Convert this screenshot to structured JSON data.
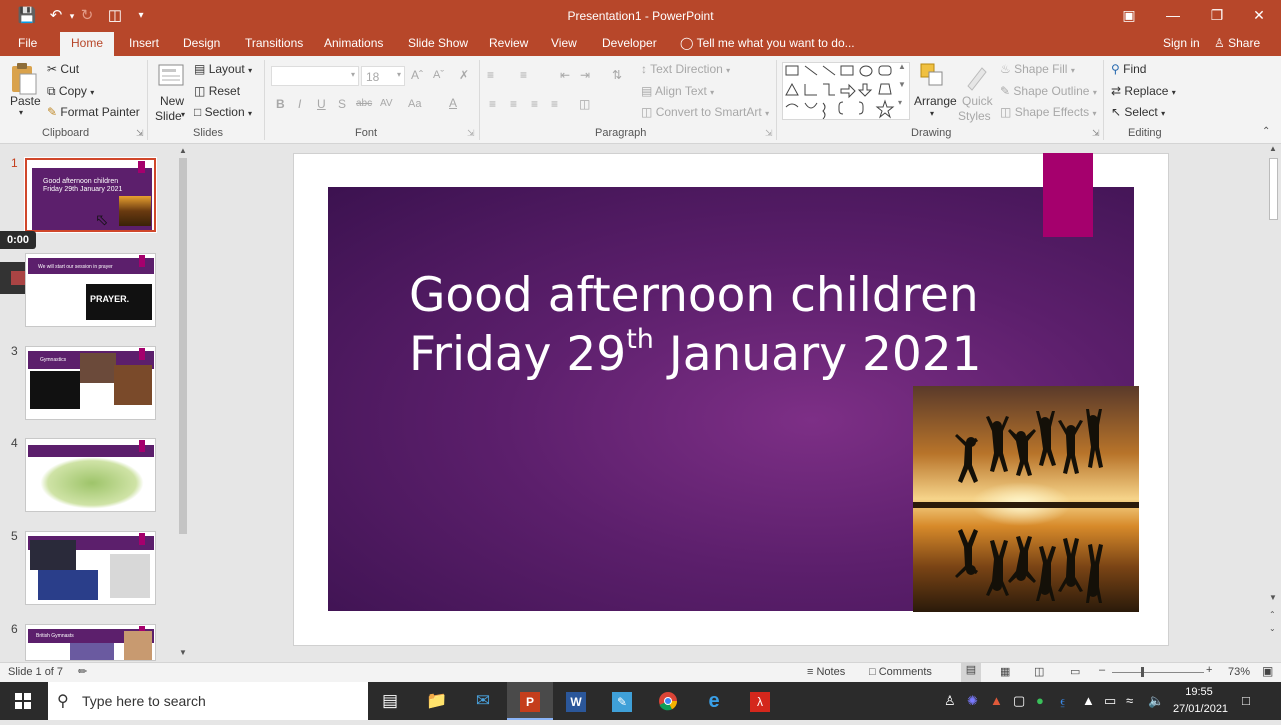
{
  "window": {
    "title": "Presentation1 - PowerPoint"
  },
  "tabs": [
    {
      "label": "File"
    },
    {
      "label": "Home"
    },
    {
      "label": "Insert"
    },
    {
      "label": "Design"
    },
    {
      "label": "Transitions"
    },
    {
      "label": "Animations"
    },
    {
      "label": "Slide Show"
    },
    {
      "label": "Review"
    },
    {
      "label": "View"
    },
    {
      "label": "Developer"
    }
  ],
  "tell_me": "Tell me what you want to do...",
  "sign_in": "Sign in",
  "share": "Share",
  "clipboard": {
    "paste": "Paste",
    "cut": "Cut",
    "copy": "Copy",
    "format_painter": "Format Painter",
    "label": "Clipboard"
  },
  "slides_group": {
    "new_slide_1": "New",
    "new_slide_2": "Slide",
    "layout": "Layout",
    "reset": "Reset",
    "section": "Section",
    "label": "Slides"
  },
  "font_group": {
    "size": "18",
    "label": "Font",
    "bold": "B",
    "italic": "I",
    "underline": "U",
    "shadow": "S",
    "strike": "abc",
    "spacing": "AV",
    "case": "Aa",
    "color": "A"
  },
  "paragraph_group": {
    "text_direction": "Text Direction",
    "align_text": "Align Text",
    "convert_smartart": "Convert to SmartArt",
    "label": "Paragraph"
  },
  "drawing_group": {
    "arrange": "Arrange",
    "quick_styles_1": "Quick",
    "quick_styles_2": "Styles",
    "shape_fill": "Shape Fill",
    "shape_outline": "Shape Outline",
    "shape_effects": "Shape Effects",
    "label": "Drawing"
  },
  "editing_group": {
    "find": "Find",
    "replace": "Replace",
    "select": "Select",
    "label": "Editing"
  },
  "thumbnails": [
    {
      "num": "1",
      "title": "Good afternoon children",
      "subtitle": "Friday 29th January 2021"
    },
    {
      "num": "2",
      "title": "We will start our session in prayer",
      "caption": "PRAYER."
    },
    {
      "num": "3",
      "title": "Gymnastics"
    },
    {
      "num": "4",
      "title": ""
    },
    {
      "num": "5",
      "title": ""
    },
    {
      "num": "6",
      "title": "British Gymnasts"
    }
  ],
  "recording": {
    "time": "0:00"
  },
  "slide": {
    "title_line1": "Good afternoon children",
    "title_line2_a": "Friday 29",
    "title_line2_sup": "th",
    "title_line2_b": " January 2021"
  },
  "status": {
    "slide_info": "Slide 1 of 7",
    "notes": "Notes",
    "comments": "Comments",
    "zoom": "73%"
  },
  "taskbar": {
    "search_placeholder": "Type here to search",
    "time": "19:55",
    "date": "27/01/2021"
  },
  "colors": {
    "accent": "#b7472a",
    "slide_band": "#5c1f6c",
    "slide_pink": "#a5006d"
  }
}
